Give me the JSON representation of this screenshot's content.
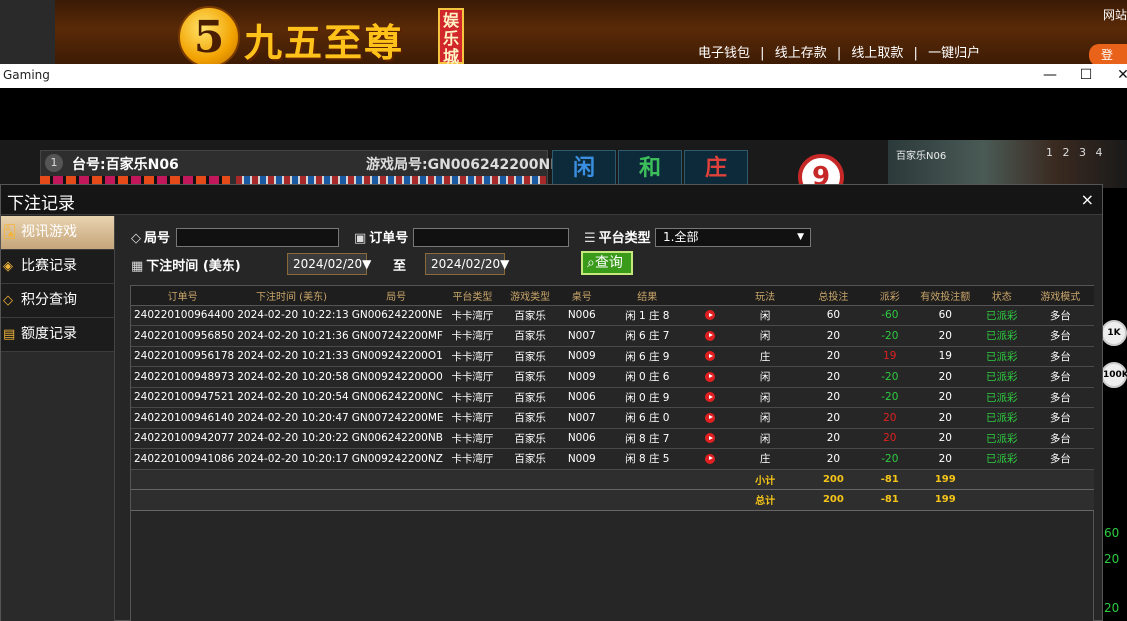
{
  "banner": {
    "logo_digit": "5",
    "logo_text": "九五至尊",
    "logo_tag": "娱乐城",
    "links": [
      "电子钱包",
      "|",
      "线上存款",
      "|",
      "线上取款",
      "|",
      "一键归户"
    ],
    "corner_text": "网站",
    "corner_button": "登"
  },
  "window": {
    "title": "Gaming",
    "minimize_icon": "—",
    "maximize_icon": "☐",
    "close_icon": "✕"
  },
  "game": {
    "table_number": "1",
    "table_label": "台号:百家乐N06",
    "round_label": "游戏局号:GN006242200NF",
    "tiles": [
      "闲",
      "和",
      "庄"
    ],
    "result_number": "9",
    "side_video_label": "百家乐N06",
    "side_digits": "1 2 3 4",
    "side_chips": [
      "1K",
      "100K"
    ],
    "side_numbers": [
      "60",
      "20",
      "20"
    ]
  },
  "modal": {
    "title": "下注记录",
    "close": "×",
    "nav": [
      {
        "label": "视讯游戏",
        "icon": "cards-icon",
        "glyph": "🂡",
        "active": true
      },
      {
        "label": "比赛记录",
        "icon": "tag-icon",
        "glyph": "◈",
        "active": false
      },
      {
        "label": "积分查询",
        "icon": "diamond-icon",
        "glyph": "◇",
        "active": false
      },
      {
        "label": "额度记录",
        "icon": "document-icon",
        "glyph": "▤",
        "active": false
      }
    ],
    "filters": {
      "round_label": "局号",
      "round_value": "",
      "order_label": "订单号",
      "order_value": "",
      "platform_label": "平台类型",
      "platform_value": "1.全部",
      "time_label": "下注时间 (美东)",
      "date_from": "2024/02/20",
      "date_to_label": "至",
      "date_to": "2024/02/20",
      "query_button": "查询"
    },
    "table": {
      "headers": [
        "订单号",
        "下注时间 (美东)",
        "局号",
        "平台类型",
        "游戏类型",
        "桌号",
        "结果",
        "",
        "玩法",
        "总投注",
        "派彩",
        "有效投注额",
        "状态",
        "游戏模式"
      ],
      "rows": [
        [
          "240220100964400",
          "2024-02-20 10:22:13",
          "GN006242200NE",
          "卡卡湾厅",
          "百家乐",
          "N006",
          "闲 1 庄 8",
          "闲",
          "60",
          "-60",
          "60",
          "已派彩",
          "多台"
        ],
        [
          "240220100956850",
          "2024-02-20 10:21:36",
          "GN007242200MF",
          "卡卡湾厅",
          "百家乐",
          "N007",
          "闲 6 庄 7",
          "闲",
          "20",
          "-20",
          "20",
          "已派彩",
          "多台"
        ],
        [
          "240220100956178",
          "2024-02-20 10:21:33",
          "GN009242200O1",
          "卡卡湾厅",
          "百家乐",
          "N009",
          "闲 6 庄 9",
          "庄",
          "20",
          "19",
          "19",
          "已派彩",
          "多台"
        ],
        [
          "240220100948973",
          "2024-02-20 10:20:58",
          "GN009242200O0",
          "卡卡湾厅",
          "百家乐",
          "N009",
          "闲 0 庄 6",
          "闲",
          "20",
          "-20",
          "20",
          "已派彩",
          "多台"
        ],
        [
          "240220100947521",
          "2024-02-20 10:20:54",
          "GN006242200NC",
          "卡卡湾厅",
          "百家乐",
          "N006",
          "闲 0 庄 9",
          "闲",
          "20",
          "-20",
          "20",
          "已派彩",
          "多台"
        ],
        [
          "240220100946140",
          "2024-02-20 10:20:47",
          "GN007242200ME",
          "卡卡湾厅",
          "百家乐",
          "N007",
          "闲 6 庄 0",
          "闲",
          "20",
          "20",
          "20",
          "已派彩",
          "多台"
        ],
        [
          "240220100942077",
          "2024-02-20 10:20:22",
          "GN006242200NB",
          "卡卡湾厅",
          "百家乐",
          "N006",
          "闲 8 庄 7",
          "闲",
          "20",
          "20",
          "20",
          "已派彩",
          "多台"
        ],
        [
          "240220100941086",
          "2024-02-20 10:20:17",
          "GN009242200NZ",
          "卡卡湾厅",
          "百家乐",
          "N009",
          "闲 8 庄 5",
          "庄",
          "20",
          "-20",
          "20",
          "已派彩",
          "多台"
        ]
      ],
      "payout_colors": [
        "pos",
        "pos",
        "neg",
        "pos",
        "pos",
        "neg",
        "neg",
        "pos"
      ],
      "subtotal": {
        "label": "小计",
        "total": "200",
        "payout": "-81",
        "valid": "199"
      },
      "grand_total": {
        "label": "总计",
        "total": "200",
        "payout": "-81",
        "valid": "199"
      }
    }
  },
  "colors": {
    "accent_gold": "#c9a56a",
    "positive": "#2ecc40",
    "negative": "#e02020",
    "query_green": "#3a9a1a"
  }
}
